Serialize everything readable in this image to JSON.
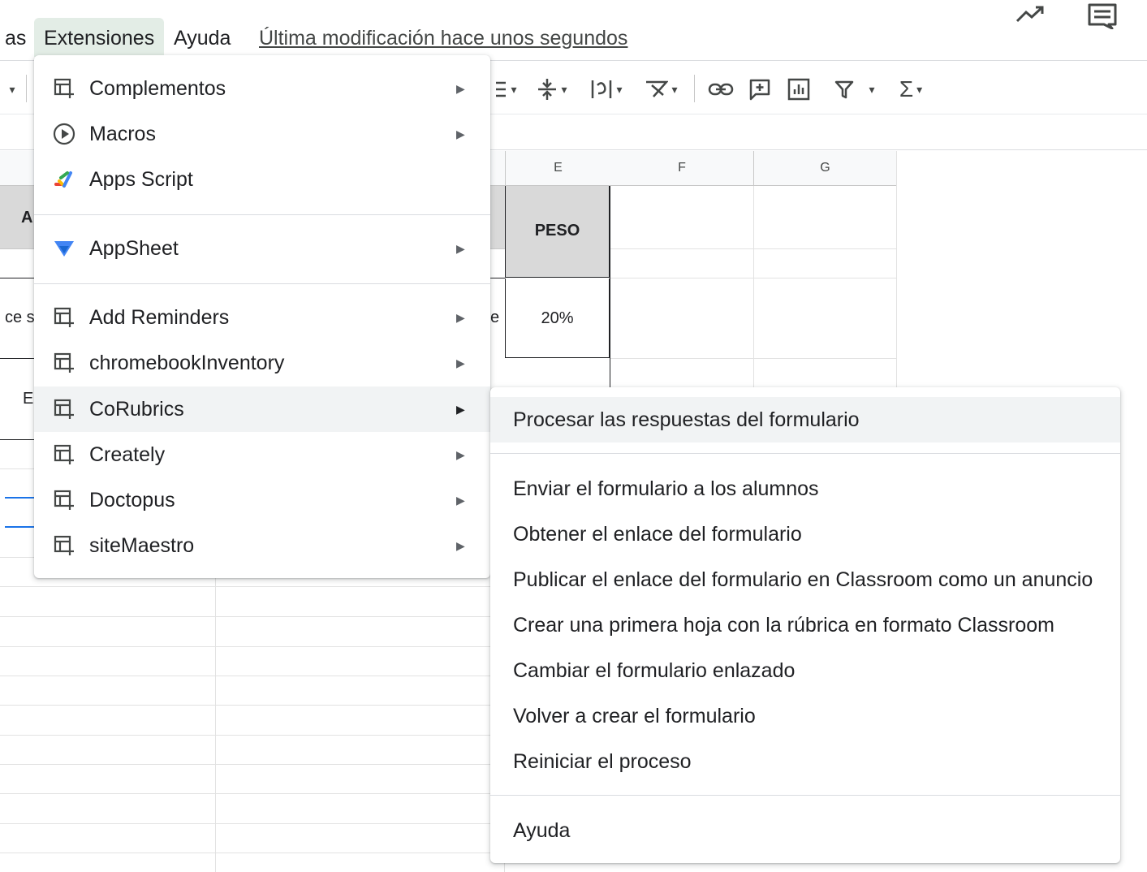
{
  "menubar": {
    "partial_label": "as",
    "extensions_label": "Extensiones",
    "help_label": "Ayuda",
    "last_edit": "Última modificación hace unos segundos"
  },
  "toolbar": {
    "icons": [
      "align-icon",
      "line-spacing-icon",
      "text-direction-icon",
      "text-rotation-icon",
      "link-icon",
      "comment-icon",
      "chart-icon",
      "filter-icon",
      "functions-icon"
    ]
  },
  "grid": {
    "column_headers": [
      "E",
      "F",
      "G"
    ],
    "cells": {
      "peso_header": "PESO",
      "peso_value": "20%",
      "partial_a": "A",
      "partial_row": "ce s",
      "partial_e": "E",
      "partial_col_d": "e"
    }
  },
  "extensions_menu": {
    "items": [
      {
        "label": "Complementos",
        "icon": "add-on-icon",
        "submenu": true
      },
      {
        "label": "Macros",
        "icon": "play-circle-icon",
        "submenu": true
      },
      {
        "label": "Apps Script",
        "icon": "apps-script-icon",
        "submenu": false
      },
      {
        "label": "AppSheet",
        "icon": "appsheet-icon",
        "submenu": true
      },
      {
        "label": "Add Reminders",
        "icon": "add-on-icon",
        "submenu": true
      },
      {
        "label": "chromebookInventory",
        "icon": "add-on-icon",
        "submenu": true
      },
      {
        "label": "CoRubrics",
        "icon": "add-on-icon",
        "submenu": true,
        "active": true
      },
      {
        "label": "Creately",
        "icon": "add-on-icon",
        "submenu": true
      },
      {
        "label": "Doctopus",
        "icon": "add-on-icon",
        "submenu": true
      },
      {
        "label": "siteMaestro",
        "icon": "add-on-icon",
        "submenu": true
      }
    ]
  },
  "corubrics_submenu": {
    "items": [
      {
        "label": "Procesar las respuestas del formulario",
        "active": true
      },
      {
        "label": "Enviar el formulario a los alumnos"
      },
      {
        "label": "Obtener el enlace del formulario"
      },
      {
        "label": "Publicar el enlace del formulario en Classroom como un anuncio"
      },
      {
        "label": "Crear una primera hoja con la rúbrica en formato Classroom"
      },
      {
        "label": "Cambiar el formulario enlazado"
      },
      {
        "label": "Volver a crear el formulario"
      },
      {
        "label": "Reiniciar el proceso"
      },
      {
        "label": "Ayuda"
      }
    ]
  },
  "colors": {
    "active_menu_bg": "#e3ede6",
    "hover_bg": "#f1f3f4",
    "selection_blue": "#1a73e8"
  }
}
